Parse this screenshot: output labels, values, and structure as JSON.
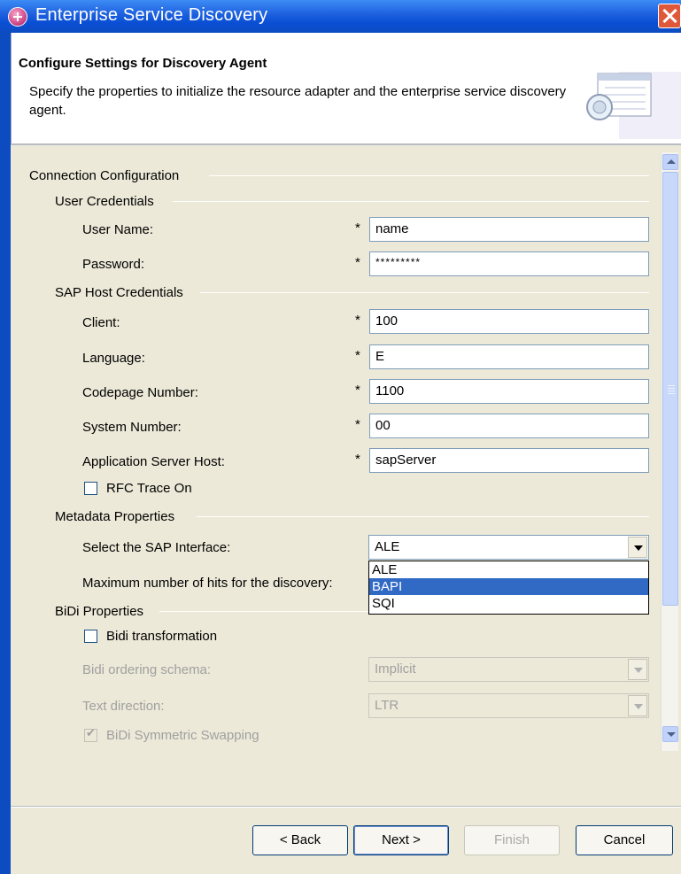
{
  "window": {
    "title": "Enterprise Service Discovery"
  },
  "banner": {
    "title": "Configure Settings for Discovery Agent",
    "description": "Specify the properties to initialize the resource adapter and the enterprise service discovery agent."
  },
  "form": {
    "connection_group": "Connection Configuration",
    "user_credentials_group": "User Credentials",
    "required_marker": "*",
    "user_name": {
      "label": "User Name:",
      "value": "name"
    },
    "password": {
      "label": "Password:",
      "value": "*********"
    },
    "sap_host_group": "SAP Host Credentials",
    "client": {
      "label": "Client:",
      "value": "100"
    },
    "language": {
      "label": "Language:",
      "value": "E"
    },
    "codepage": {
      "label": "Codepage Number:",
      "value": "1100"
    },
    "system_number": {
      "label": "System Number:",
      "value": "00"
    },
    "app_server_host": {
      "label": "Application Server Host:",
      "value": "sapServer"
    },
    "rfc_trace": {
      "label": "RFC Trace On",
      "checked": false
    },
    "metadata_group": "Metadata Properties",
    "sap_interface": {
      "label": "Select the SAP Interface:",
      "value": "ALE",
      "options": [
        "ALE",
        "BAPI",
        "SQI"
      ],
      "highlighted": "BAPI"
    },
    "max_hits": {
      "label": "Maximum number of hits for the discovery:"
    },
    "bidi_group": "BiDi Properties",
    "bidi_transformation": {
      "label": "Bidi transformation",
      "checked": false
    },
    "bidi_ordering": {
      "label": "Bidi ordering schema:",
      "value": "Implicit"
    },
    "text_direction": {
      "label": "Text direction:",
      "value": "LTR"
    },
    "bidi_symmetric": {
      "label": "BiDi Symmetric Swapping",
      "checked": true
    }
  },
  "buttons": {
    "back": "< Back",
    "next": "Next >",
    "finish": "Finish",
    "cancel": "Cancel"
  },
  "colors": {
    "titlebar": "#0a4fd4",
    "dialog_bg": "#ece9d8",
    "selection": "#316ac5"
  }
}
